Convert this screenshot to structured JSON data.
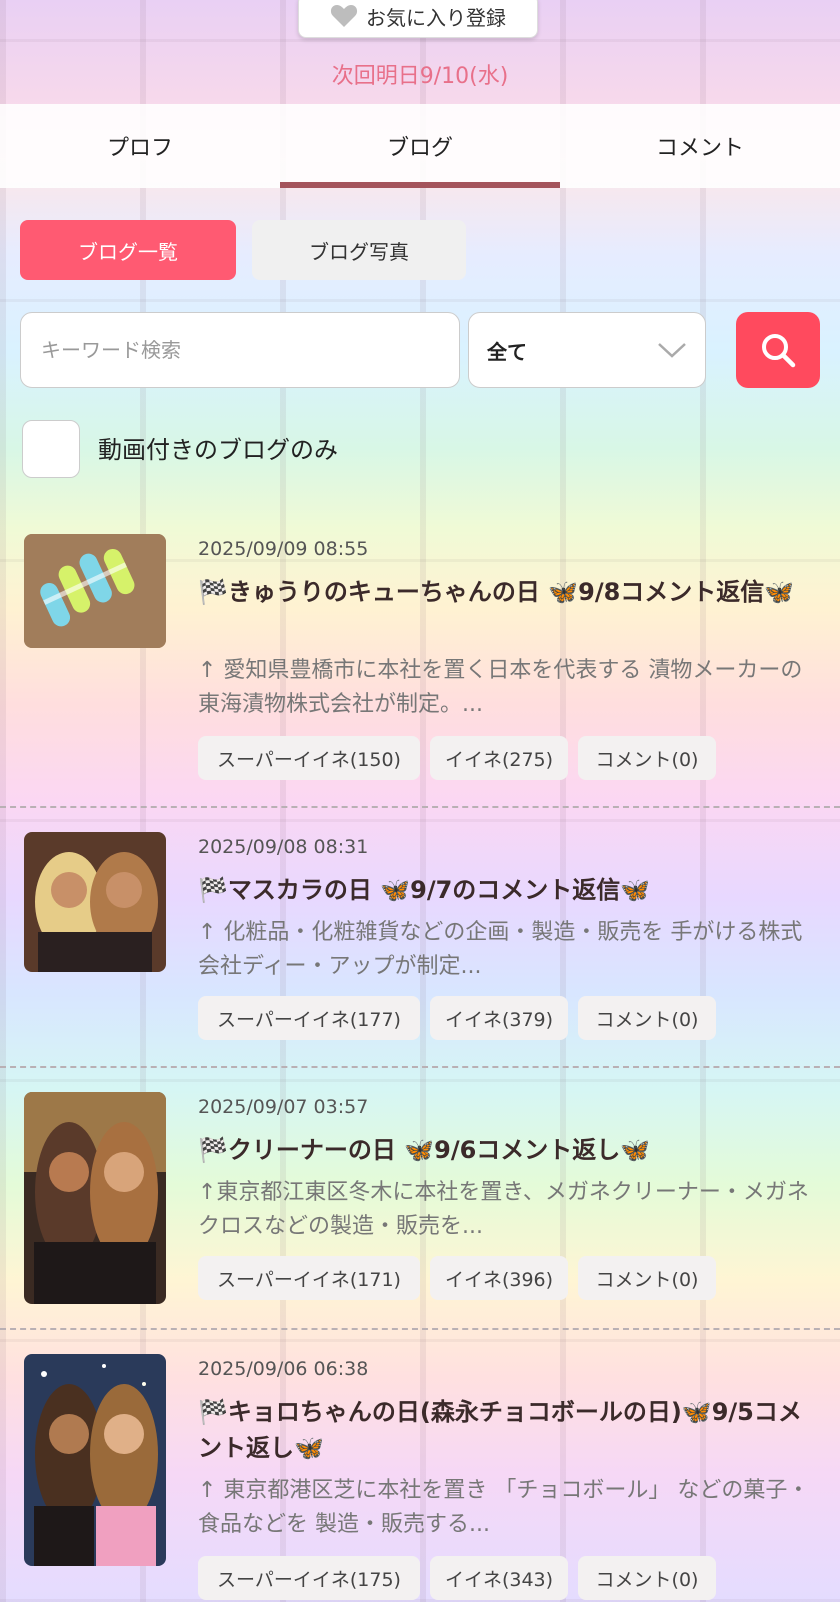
{
  "favorite": {
    "label": "お気に入り登録"
  },
  "next_time": "次回明日9/10(水)",
  "tabs": [
    {
      "label": "プロフ"
    },
    {
      "label": "ブログ"
    },
    {
      "label": "コメント"
    }
  ],
  "subnav": {
    "list_label": "ブログ一覧",
    "photo_label": "ブログ写真"
  },
  "search": {
    "placeholder": "キーワード検索",
    "category_value": "全て"
  },
  "filter": {
    "video_only_label": "動画付きのブログのみ"
  },
  "posts": [
    {
      "date": "2025/09/09 08:55",
      "title": "🏁きゅうりのキューちゃんの日 🦋9/8コメント返信🦋",
      "excerpt": "↑ 愛知県豊橋市に本社を置く日本を代表する 漬物メーカーの東海漬物株式会社が制定。...",
      "super_like": "スーパーイイネ(150)",
      "like": "イイネ(275)",
      "comment": "コメント(0)"
    },
    {
      "date": "2025/09/08 08:31",
      "title": "🏁マスカラの日 🦋9/7のコメント返信🦋",
      "excerpt": "↑ 化粧品・化粧雑貨などの企画・製造・販売を 手がける株式会社ディー・アップが制定...",
      "super_like": "スーパーイイネ(177)",
      "like": "イイネ(379)",
      "comment": "コメント(0)"
    },
    {
      "date": "2025/09/07 03:57",
      "title": "🏁クリーナーの日 🦋9/6コメント返し🦋",
      "excerpt": "↑東京都江東区冬木に本社を置き、メガネクリーナー・メガネクロスなどの製造・販売を...",
      "super_like": "スーパーイイネ(171)",
      "like": "イイネ(396)",
      "comment": "コメント(0)"
    },
    {
      "date": "2025/09/06 06:38",
      "title": "🏁キョロちゃんの日(森永チョコボールの日)🦋9/5コメント返し🦋",
      "excerpt": "↑ 東京都港区芝に本社を置き 「チョコボール」 などの菓子・食品などを 製造・販売する...",
      "super_like": "スーパーイイネ(175)",
      "like": "イイネ(343)",
      "comment": "コメント(0)"
    }
  ],
  "colors": {
    "accent": "#ff5a72",
    "tab_underline": "#a4545c",
    "next_time": "#e8708a"
  },
  "icons": {
    "favorite": "heart-icon",
    "search": "search-icon",
    "dropdown": "chevron-down-icon"
  }
}
